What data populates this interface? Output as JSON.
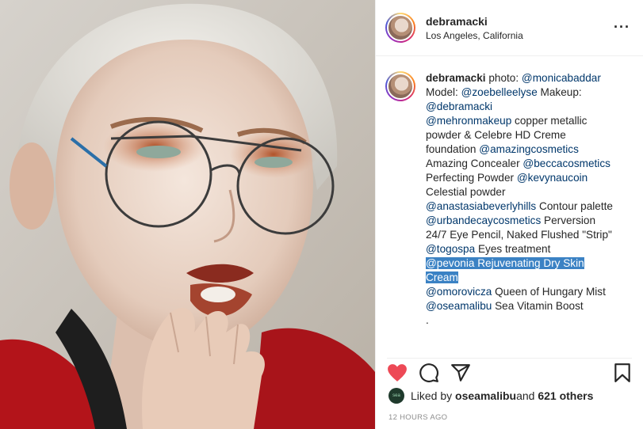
{
  "header": {
    "username": "debramacki",
    "location": "Los Angeles, California",
    "more_icon": "more-horizontal-icon"
  },
  "caption": {
    "username": "debramacki",
    "segments": {
      "s1": " photo: ",
      "m1": "@monicabaddar",
      "s2": " Model: ",
      "m2": "@zoebelleelyse",
      "s3": " Makeup: ",
      "m3": "@debramacki",
      "m4": "@mehronmakeup",
      "s4": " copper metallic powder & Celebre HD Creme foundation ",
      "m5": "@amazingcosmetics",
      "s5": " Amazing Concealer ",
      "m6": "@beccacosmetics",
      "s6": " Perfecting Powder ",
      "m7": "@kevynaucoin",
      "s7": " Celestial powder ",
      "m8": "@anastasiabeverlyhills",
      "s8": " Contour palette ",
      "m9": "@urbandecaycosmetics",
      "s9": " Perversion 24/7 Eye Pencil, Naked Flushed \"Strip\" ",
      "m10": "@togospa",
      "s10": " Eyes treatment ",
      "hl": "@pevonia Rejuvenating Dry Skin Cream",
      "m11": "@omorovicza",
      "s11": " Queen of Hungary Mist ",
      "m12": "@oseamalibu",
      "s12": " Sea Vitamin Boost",
      "tail": "."
    }
  },
  "actions": {
    "like_icon": "heart-filled-icon",
    "comment_icon": "comment-icon",
    "share_icon": "share-icon",
    "save_icon": "bookmark-icon",
    "like_color": "#ed4956"
  },
  "likes": {
    "avatar_text": "sea",
    "prefix": "Liked by ",
    "user": "oseamalibu",
    "middle": " and ",
    "others": "621 others"
  },
  "timestamp": "12 HOURS AGO"
}
